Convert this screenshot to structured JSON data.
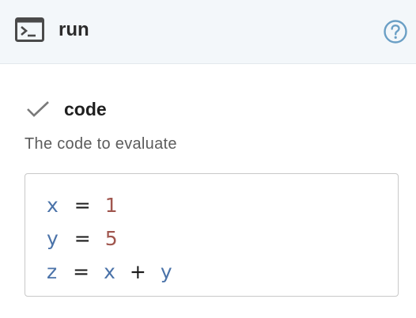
{
  "header": {
    "icon": "terminal-icon",
    "title": "run",
    "help_icon": "help-circle-icon",
    "accent_color": "#6a9fc5"
  },
  "parameter": {
    "status_icon": "check-icon",
    "name": "code",
    "description": "The code to evaluate"
  },
  "code": {
    "lines": [
      [
        {
          "t": "x",
          "k": "var"
        },
        {
          "t": "=",
          "k": "op"
        },
        {
          "t": "1",
          "k": "num"
        }
      ],
      [
        {
          "t": "y",
          "k": "var"
        },
        {
          "t": "=",
          "k": "op"
        },
        {
          "t": "5",
          "k": "num"
        }
      ],
      [
        {
          "t": "z",
          "k": "var"
        },
        {
          "t": "=",
          "k": "op"
        },
        {
          "t": "x",
          "k": "var"
        },
        {
          "t": "+",
          "k": "op"
        },
        {
          "t": "y",
          "k": "var"
        }
      ]
    ],
    "colors": {
      "var": "#4b73a9",
      "op": "#1a1a1a",
      "num": "#a0564e"
    }
  }
}
